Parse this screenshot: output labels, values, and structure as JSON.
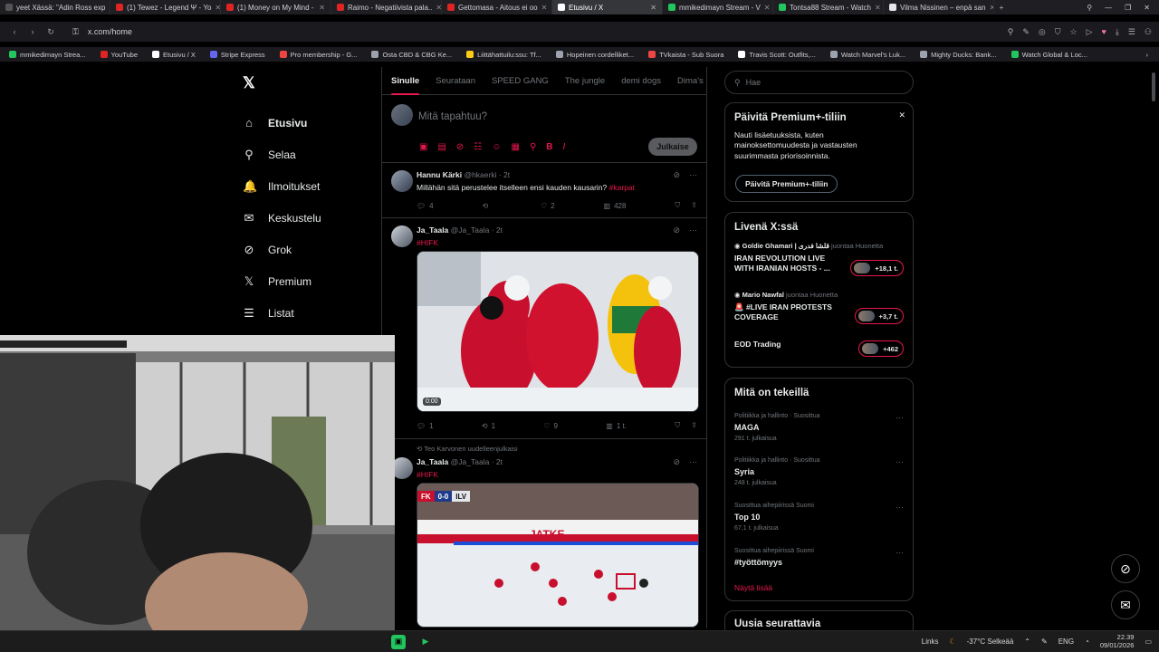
{
  "browser": {
    "tabs": [
      {
        "label": "yeet Xässä: \"Adin Ross exp",
        "color": "#555"
      },
      {
        "label": "(1) Tewez - Legend Ψ - Yo",
        "color": "#e02424"
      },
      {
        "label": "(1) Money on My Mind -",
        "color": "#e02424"
      },
      {
        "label": "Raimo - Negatiivista pala..",
        "color": "#e02424"
      },
      {
        "label": "Gettomasa - Aitous ei oo",
        "color": "#e02424"
      },
      {
        "label": "Etusivu / X",
        "color": "#fff"
      },
      {
        "label": "mmikedimayn Stream - V",
        "color": "#22c55e"
      },
      {
        "label": "Tontsa88 Stream - Watch",
        "color": "#22c55e"
      },
      {
        "label": "Vilma Nissinen – enpä san",
        "color": "#e5e7eb"
      }
    ],
    "url": "x.com/home",
    "bookmarks": [
      {
        "label": "mmikedimayn Strea...",
        "color": "#22c55e"
      },
      {
        "label": "YouTube",
        "color": "#e02424"
      },
      {
        "label": "Etusivu / X",
        "color": "#fff"
      },
      {
        "label": "Stripe Express",
        "color": "#6366f1"
      },
      {
        "label": "Pro membership - G...",
        "color": "#ef4444"
      },
      {
        "label": "Osta CBD & CBG Ke...",
        "color": "#9ca3af"
      },
      {
        "label": "Liittähattuilu:ssu: Tf...",
        "color": "#facc15"
      },
      {
        "label": "Hopeinen cordelliket...",
        "color": "#9ca3af"
      },
      {
        "label": "TVkaista - Sub Suora",
        "color": "#ef4444"
      },
      {
        "label": "Travis Scott: Outfits,...",
        "color": "#fff"
      },
      {
        "label": "Watch Marvel's Luk...",
        "color": "#9ca3af"
      },
      {
        "label": "Mighty Ducks: Bank...",
        "color": "#9ca3af"
      },
      {
        "label": "Watch Global & Loc...",
        "color": "#22c55e"
      }
    ]
  },
  "nav": {
    "items": [
      {
        "label": "Etusivu",
        "icon": "home-icon",
        "glyph": "⌂"
      },
      {
        "label": "Selaa",
        "icon": "search-icon",
        "glyph": "⚲"
      },
      {
        "label": "Ilmoitukset",
        "icon": "bell-icon",
        "glyph": "🔔"
      },
      {
        "label": "Keskustelu",
        "icon": "mail-icon",
        "glyph": "✉"
      },
      {
        "label": "Grok",
        "icon": "grok-icon",
        "glyph": "⊘"
      },
      {
        "label": "Premium",
        "icon": "x-icon",
        "glyph": "𝕏"
      },
      {
        "label": "Listat",
        "icon": "list-icon",
        "glyph": "☰"
      }
    ]
  },
  "feed": {
    "tabs": [
      "Sinulle",
      "Seurataan",
      "SPEED GANG",
      "The jungle",
      "demi dogs",
      "Dima's Di"
    ],
    "compose_placeholder": "Mitä tapahtuu?",
    "post_label": "Julkaise",
    "tweets": [
      {
        "name": "Hannu Kärki",
        "handle": "@hkaerki · 2t",
        "text": "Millähän sitä perustelee itselleen ensi kauden kausarin?",
        "hashtag": "#karpat",
        "replies": "4",
        "retweets": "",
        "likes": "2",
        "views": "428"
      },
      {
        "name": "Ja_Taala",
        "handle": "@Ja_Taala · 2t",
        "hashtag": "#HIFK",
        "video_time": "0:00",
        "replies": "1",
        "retweets": "1",
        "likes": "9",
        "views": "1 t."
      },
      {
        "repost_note": "Teo Karvonen uudelleenjulkaisi",
        "name": "Ja_Taala",
        "handle": "@Ja_Taala · 2t",
        "hashtag": "#HIFK",
        "score_home": "FK",
        "score": "0-0",
        "score_away": "ILV",
        "board_text": "JATKE"
      }
    ]
  },
  "right": {
    "search_placeholder": "Hae",
    "premium": {
      "title": "Päivitä Premium+-tiliin",
      "text": "Nauti lisäetuuksista, kuten mainoksettomuudesta ja vastausten suurimmasta priorisoinnista.",
      "button": "Päivitä Premium+-tiliin"
    },
    "live": {
      "title": "Livenä X:ssä",
      "items": [
        {
          "host": "Goldie Ghamari | قلشا فدرى",
          "sub": "juontaa Huonetta",
          "title": "IRAN REVOLUTION LIVE WITH IRANIAN HOSTS - ...",
          "count": "+18,1 t."
        },
        {
          "host": "Mario Nawfal",
          "sub": "juontaa Huonetta",
          "title": "🚨 #LIVE IRAN PROTESTS COVERAGE",
          "count": "+3,7 t."
        },
        {
          "host": "",
          "sub": "",
          "title": "EOD Trading",
          "count": "+462"
        }
      ]
    },
    "trends": {
      "title": "Mitä on tekeillä",
      "items": [
        {
          "category": "Politiikka ja hallinto · Suosittua",
          "name": "MAGA",
          "count": "291 t. julkaisua"
        },
        {
          "category": "Politiikka ja hallinto · Suosittua",
          "name": "Syria",
          "count": "248 t. julkaisua"
        },
        {
          "category": "Suosittua aihepiirissä Suomi",
          "name": "Top 10",
          "count": "67,1 t. julkaisua"
        },
        {
          "category": "Suosittua aihepiirissä Suomi",
          "name": "#työttömyys",
          "count": ""
        }
      ],
      "show_more": "Näytä lisää"
    },
    "new_follow_title": "Uusia seurattavia"
  },
  "taskbar": {
    "links": "Links",
    "weather": "-37°C Selkeää",
    "lang": "ENG",
    "time": "22.39",
    "date": "09/01/2026"
  },
  "colors": {
    "accent": "#e8174c",
    "background": "#000000",
    "border": "#2f3336"
  }
}
